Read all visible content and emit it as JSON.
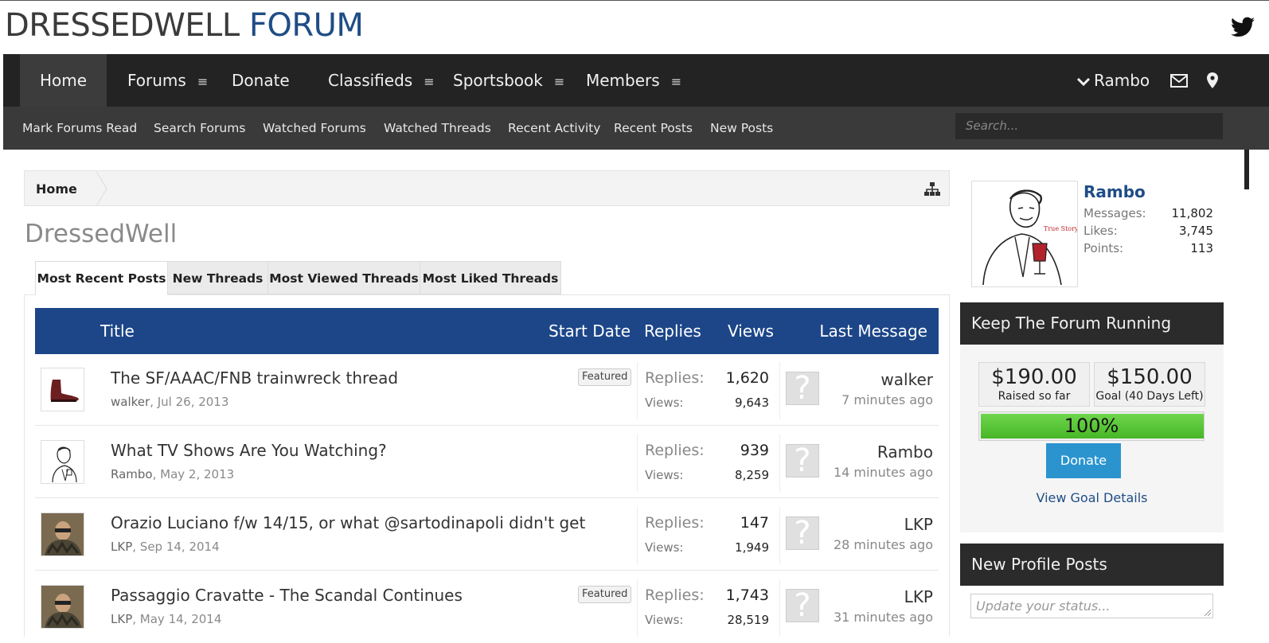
{
  "logo": {
    "part1": "DRESSEDWELL",
    "part2": "FORUM"
  },
  "nav": {
    "items": [
      {
        "label": "Home",
        "menu": false
      },
      {
        "label": "Forums",
        "menu": true
      },
      {
        "label": "Donate",
        "menu": false
      },
      {
        "label": "Classifieds",
        "menu": true
      },
      {
        "label": "Sportsbook",
        "menu": true
      },
      {
        "label": "Members",
        "menu": true
      }
    ],
    "user": "Rambo",
    "menu_glyph": "≡"
  },
  "subnav": {
    "items": [
      "Mark Forums Read",
      "Search Forums",
      "Watched Forums",
      "Watched Threads",
      "Recent Activity",
      "Recent Posts",
      "New Posts"
    ],
    "search_placeholder": "Search..."
  },
  "breadcrumb": {
    "home": "Home"
  },
  "page_title": "DressedWell",
  "tabs": [
    "Most Recent Posts",
    "New Threads",
    "Most Viewed Threads",
    "Most Liked Threads"
  ],
  "table": {
    "headers": {
      "title": "Title",
      "start_date": "Start Date",
      "replies": "Replies",
      "views": "Views",
      "last_message": "Last Message"
    },
    "replies_label": "Replies:",
    "views_label": "Views:",
    "featured_label": "Featured",
    "rows": [
      {
        "title": "The SF/AAAC/FNB trainwreck thread",
        "author": "walker",
        "date": "Jul 26, 2013",
        "featured": true,
        "replies": "1,620",
        "views": "9,643",
        "last_user": "walker",
        "last_time": "7 minutes ago"
      },
      {
        "title": "What TV Shows Are You Watching?",
        "author": "Rambo",
        "date": "May 2, 2013",
        "featured": false,
        "replies": "939",
        "views": "8,259",
        "last_user": "Rambo",
        "last_time": "14 minutes ago"
      },
      {
        "title": "Orazio Luciano f/w 14/15, or what @sartodinapoli didn't get",
        "author": "LKP",
        "date": "Sep 14, 2014",
        "featured": false,
        "replies": "147",
        "views": "1,949",
        "last_user": "LKP",
        "last_time": "28 minutes ago"
      },
      {
        "title": "Passaggio Cravatte - The Scandal Continues",
        "author": "LKP",
        "date": "May 14, 2014",
        "featured": true,
        "replies": "1,743",
        "views": "28,519",
        "last_user": "LKP",
        "last_time": "31 minutes ago"
      }
    ]
  },
  "profile": {
    "name": "Rambo",
    "stats": [
      {
        "label": "Messages:",
        "value": "11,802"
      },
      {
        "label": "Likes:",
        "value": "3,745"
      },
      {
        "label": "Points:",
        "value": "113"
      }
    ],
    "avatar_caption": "True Story"
  },
  "donation": {
    "heading": "Keep The Forum Running",
    "raised": "$190.00",
    "raised_caption": "Raised so far",
    "goal": "$150.00",
    "goal_caption": "Goal (40 Days Left)",
    "progress_text": "100%",
    "progress_fraction": 1.0,
    "donate_label": "Donate",
    "details_link": "View Goal Details"
  },
  "profile_posts": {
    "heading": "New Profile Posts",
    "status_placeholder": "Update your status..."
  },
  "colors": {
    "brand_blue": "#1c4688",
    "nav_dark": "#232323",
    "progress_green": "#5cc93a",
    "donate_blue": "#2b94cf"
  }
}
